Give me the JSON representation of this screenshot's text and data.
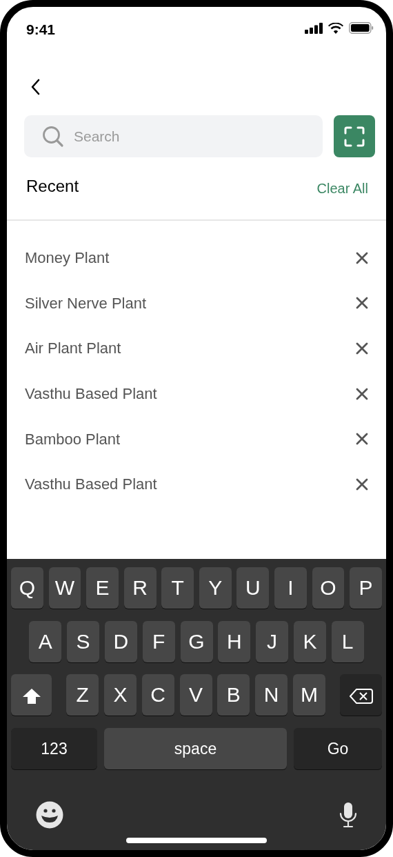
{
  "status_bar": {
    "time": "9:41"
  },
  "search": {
    "placeholder": "Search"
  },
  "recent": {
    "title": "Recent",
    "clear_label": "Clear All",
    "items": [
      {
        "label": "Money Plant"
      },
      {
        "label": "Silver Nerve Plant"
      },
      {
        "label": "Air Plant Plant"
      },
      {
        "label": "Vasthu Based Plant"
      },
      {
        "label": "Bamboo Plant"
      },
      {
        "label": "Vasthu Based Plant"
      }
    ]
  },
  "keyboard": {
    "rows": [
      [
        "Q",
        "W",
        "E",
        "R",
        "T",
        "Y",
        "U",
        "I",
        "O",
        "P"
      ],
      [
        "A",
        "S",
        "D",
        "F",
        "G",
        "H",
        "J",
        "K",
        "L"
      ],
      [
        "Z",
        "X",
        "C",
        "V",
        "B",
        "N",
        "M"
      ]
    ],
    "numbers_key": "123",
    "space_key": "space",
    "go_key": "Go"
  }
}
